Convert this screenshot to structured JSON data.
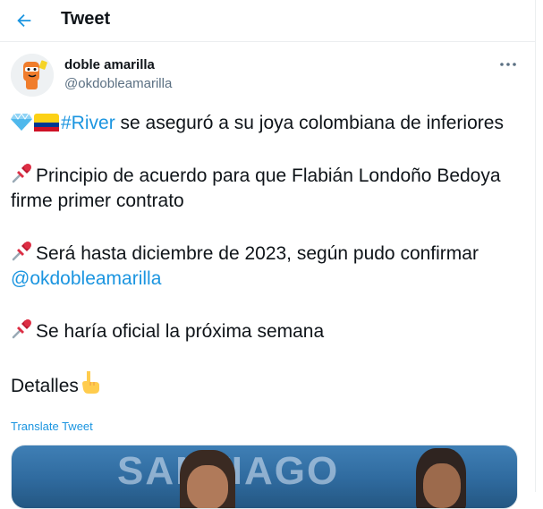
{
  "header": {
    "title": "Tweet",
    "back_icon": "arrow-left-icon"
  },
  "author": {
    "name": "doble amarilla",
    "handle": "@okdobleamarilla",
    "avatar_icon": "orange-mascot-avatar"
  },
  "more_icon": "more-horizontal-icon",
  "tweet": {
    "line1": {
      "emoji1": "diamond-emoji",
      "emoji2": "colombia-flag-emoji",
      "hashtag": "#River",
      "text": " se aseguró a su joya colombiana de inferiores"
    },
    "line2": {
      "emoji": "pushpin-emoji",
      "text": "Principio de acuerdo para que Flabián Londoño Bedoya firme primer contrato"
    },
    "line3": {
      "emoji": "pushpin-emoji",
      "text": "Será hasta diciembre de 2023, según pudo confirmar ",
      "mention": "@okdobleamarilla"
    },
    "line4": {
      "emoji": "pushpin-emoji",
      "text": "Se haría oficial la próxima semana"
    },
    "line5": {
      "text": "Detalles",
      "emoji": "pointing-down-emoji"
    }
  },
  "translate_label": "Translate Tweet",
  "media": {
    "overlay_text": "SANTIAGO"
  },
  "colors": {
    "accent": "#1b95e0",
    "text": "#0f1419",
    "secondary": "#5b7083",
    "border": "#ebeef0"
  }
}
